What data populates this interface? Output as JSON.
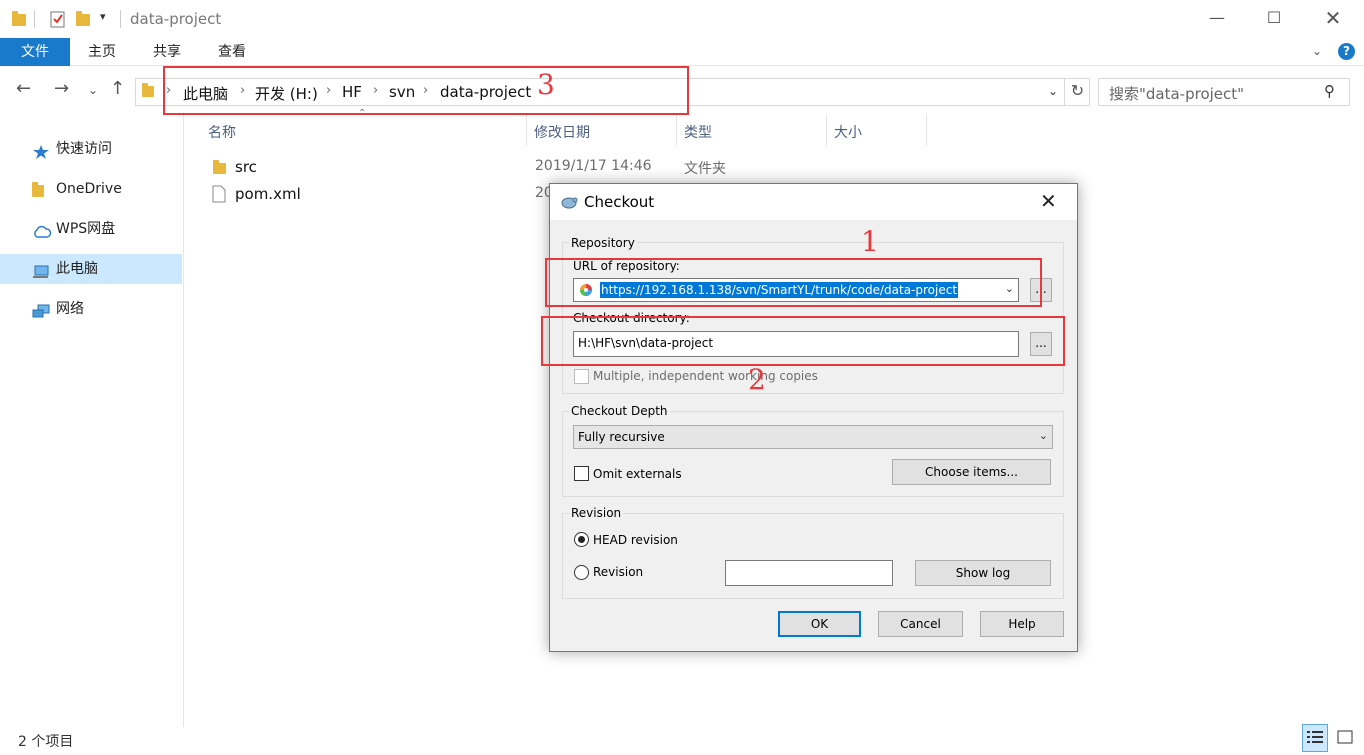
{
  "window": {
    "title": "data-project"
  },
  "ribbon": {
    "tabs": [
      "文件",
      "主页",
      "共享",
      "查看"
    ]
  },
  "address": {
    "crumbs": [
      "此电脑",
      "开发 (H:)",
      "HF",
      "svn",
      "data-project"
    ],
    "search_placeholder": "搜索\"data-project\""
  },
  "sidebar": {
    "items": [
      "快速访问",
      "OneDrive",
      "WPS网盘",
      "此电脑",
      "网络"
    ]
  },
  "file_list": {
    "columns": [
      "名称",
      "修改日期",
      "类型",
      "大小"
    ],
    "rows": [
      {
        "name": "src",
        "date": "2019/1/17 14:46",
        "type": "文件夹"
      },
      {
        "name": "pom.xml",
        "date": "20",
        "type": ""
      }
    ]
  },
  "status": {
    "count": "2 个项目"
  },
  "annotations": {
    "label1": "1",
    "label2": "2",
    "label3": "3",
    "color": "#e8383d"
  },
  "dialog": {
    "title": "Checkout",
    "repository_group": "Repository",
    "url_label": "URL of repository:",
    "url_value": "https://192.168.1.138/svn/SmartYL/trunk/code/data-project",
    "browse_label": "...",
    "checkout_dir_label": "Checkout directory:",
    "checkout_dir_value": "H:\\HF\\svn\\data-project",
    "multiple_label": "Multiple, independent working copies",
    "depth_group": "Checkout Depth",
    "depth_value": "Fully recursive",
    "omit_externals_label": "Omit externals",
    "choose_items_label": "Choose items...",
    "revision_group": "Revision",
    "head_revision_label": "HEAD revision",
    "revision_label": "Revision",
    "show_log_label": "Show log",
    "ok_label": "OK",
    "cancel_label": "Cancel",
    "help_label": "Help"
  }
}
